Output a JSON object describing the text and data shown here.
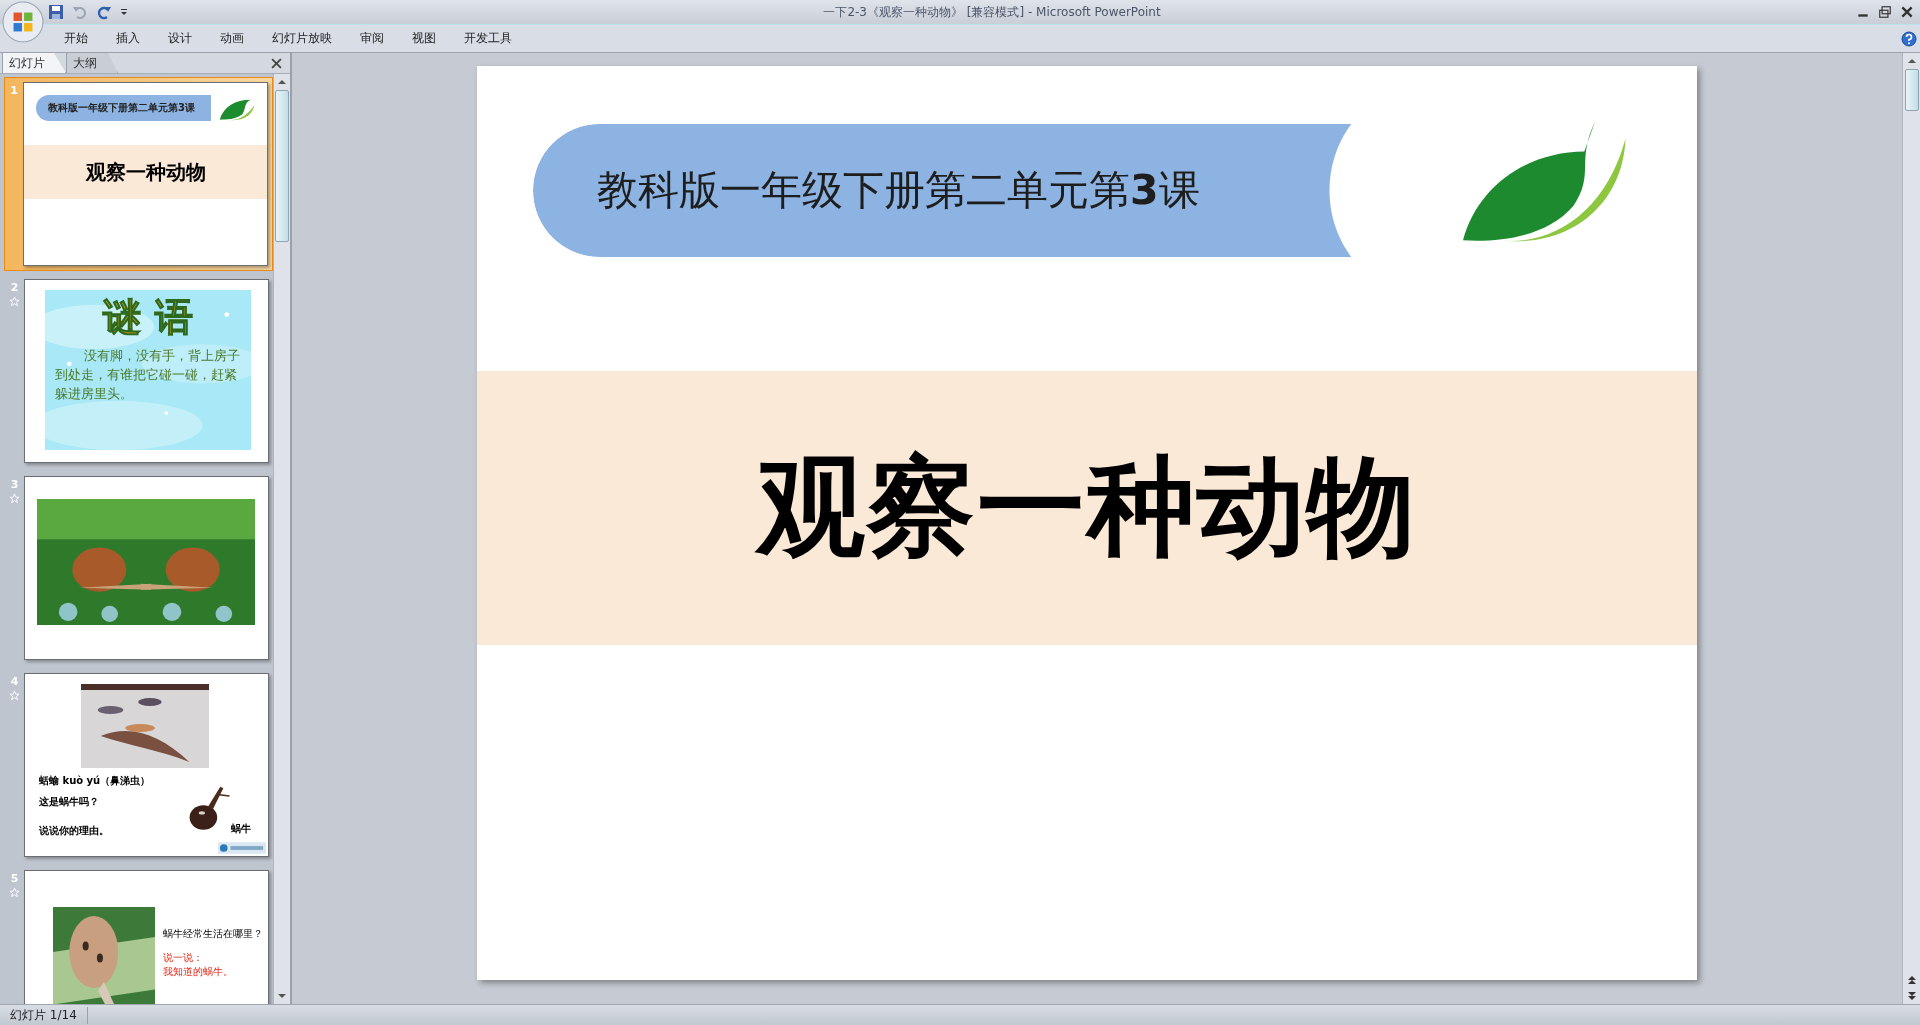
{
  "window": {
    "title": "一下2-3《观察一种动物》 [兼容模式] - Microsoft PowerPoint"
  },
  "ribbon_tabs": [
    "开始",
    "插入",
    "设计",
    "动画",
    "幻灯片放映",
    "审阅",
    "视图",
    "开发工具"
  ],
  "panel_tabs": [
    {
      "label": "幻灯片",
      "selected": true
    },
    {
      "label": "大纲",
      "selected": false
    }
  ],
  "thumbnails": [
    {
      "number": "1",
      "selected": true,
      "animated": false,
      "kind": "title",
      "banner": "教科版一年级下册第二单元第3课",
      "title": "观察一种动物"
    },
    {
      "number": "2",
      "selected": false,
      "animated": true,
      "kind": "riddle",
      "heading": "谜 语",
      "text": "没有脚，没有手，背上房子到处走，有谁把它碰一碰，赶紧躲进房里头。"
    },
    {
      "number": "3",
      "selected": false,
      "animated": true
    },
    {
      "number": "4",
      "selected": false,
      "animated": true,
      "kind": "photo_text",
      "lines": [
        "蛞蝓 kuò yú（鼻涕虫）",
        "这是蜗牛吗？",
        "说说你的理由。"
      ],
      "caption": "蜗牛"
    },
    {
      "number": "5",
      "selected": false,
      "animated": true,
      "kind": "photo_question",
      "question": "蜗牛经常生活在哪里？",
      "prompts": [
        "说一说：",
        "我知道的蜗牛。"
      ]
    }
  ],
  "slide": {
    "banner": "教科版一年级下册第二单元第**3**课",
    "title": "观察一种动物"
  },
  "status_bar": {
    "slide_indicator": "幻灯片 1/14"
  }
}
